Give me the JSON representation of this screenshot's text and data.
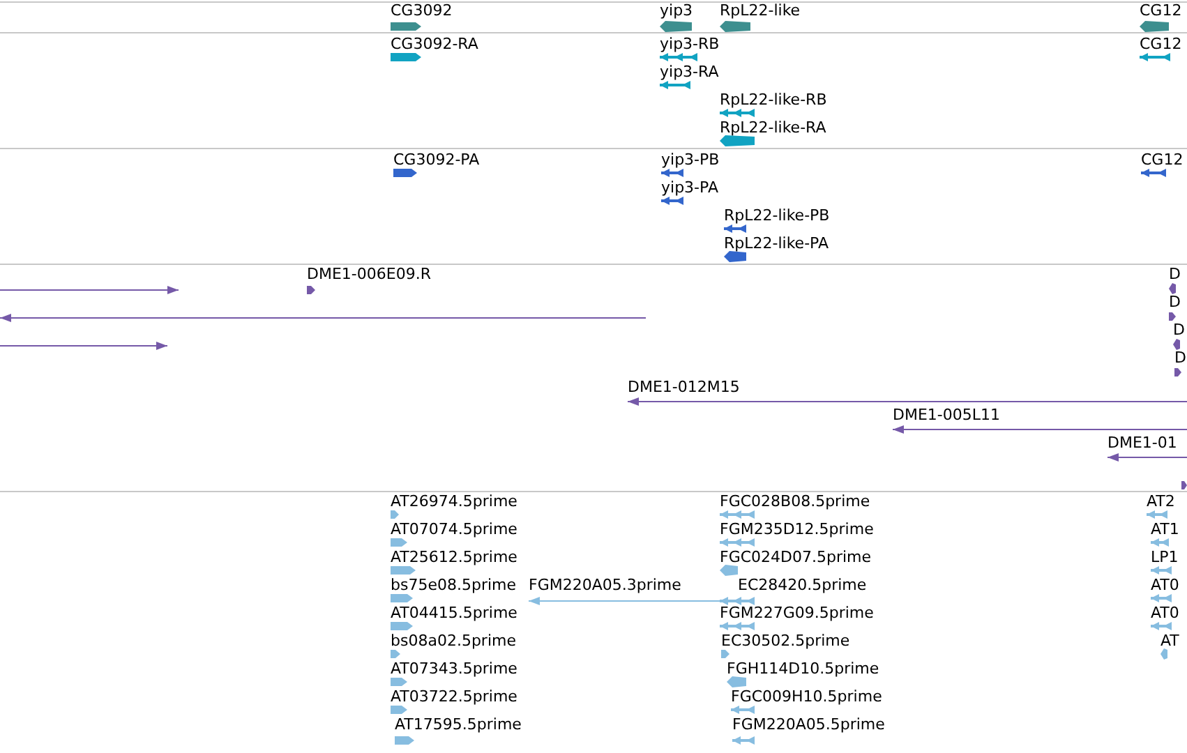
{
  "tracks": [
    {
      "color": "#3d8f8f",
      "features": [
        {
          "label": "CG3092",
          "reverse": false,
          "kind": "block"
        },
        {
          "label": "yip3",
          "reverse": true,
          "kind": "block"
        },
        {
          "label": "RpL22-like",
          "reverse": true,
          "kind": "block"
        },
        {
          "label": "CG12",
          "reverse": true,
          "kind": "block"
        }
      ]
    },
    {
      "color": "#11a3c2",
      "features": [
        {
          "label": "CG3092-RA",
          "reverse": false,
          "kind": "block"
        },
        {
          "label": "yip3-RB",
          "reverse": true,
          "kind": "spliced"
        },
        {
          "label": "yip3-RA",
          "reverse": true,
          "kind": "spliced"
        },
        {
          "label": "RpL22-like-RB",
          "reverse": true,
          "kind": "spliced"
        },
        {
          "label": "RpL22-like-RA",
          "reverse": true,
          "kind": "block"
        },
        {
          "label": "CG12",
          "reverse": true,
          "kind": "spliced"
        }
      ]
    },
    {
      "color": "#3366cc",
      "features": [
        {
          "label": "CG3092-PA",
          "reverse": false,
          "kind": "block"
        },
        {
          "label": "yip3-PB",
          "reverse": true,
          "kind": "spliced"
        },
        {
          "label": "yip3-PA",
          "reverse": true,
          "kind": "spliced"
        },
        {
          "label": "RpL22-like-PB",
          "reverse": true,
          "kind": "spliced"
        },
        {
          "label": "RpL22-like-PA",
          "reverse": true,
          "kind": "block"
        },
        {
          "label": "CG12",
          "reverse": true,
          "kind": "spliced"
        }
      ]
    },
    {
      "color": "#7559a8",
      "features": [
        {
          "reverse": false,
          "kind": "line"
        },
        {
          "label": "DME1-006E09.R",
          "reverse": false,
          "kind": "block"
        },
        {
          "reverse": true,
          "kind": "line"
        },
        {
          "reverse": false,
          "kind": "line"
        },
        {
          "label": "D",
          "reverse": true,
          "kind": "block"
        },
        {
          "label": "D",
          "reverse": false,
          "kind": "block"
        },
        {
          "label": "D",
          "reverse": true,
          "kind": "block"
        },
        {
          "label": "D",
          "reverse": false,
          "kind": "block"
        },
        {
          "label": "DME1-012M15",
          "reverse": true,
          "kind": "line"
        },
        {
          "label": "DME1-005L11",
          "reverse": true,
          "kind": "line"
        },
        {
          "label": "DME1-01",
          "reverse": true,
          "kind": "line"
        },
        {
          "reverse": false,
          "kind": "block"
        }
      ]
    },
    {
      "color": "#87bde0",
      "features": [
        {
          "label": "AT26974.5prime",
          "reverse": false,
          "kind": "block"
        },
        {
          "label": "AT07074.5prime",
          "reverse": false,
          "kind": "block"
        },
        {
          "label": "AT25612.5prime",
          "reverse": false,
          "kind": "block"
        },
        {
          "label": "bs75e08.5prime",
          "reverse": false,
          "kind": "block"
        },
        {
          "label": "AT04415.5prime",
          "reverse": false,
          "kind": "block"
        },
        {
          "label": "bs08a02.5prime",
          "reverse": false,
          "kind": "block"
        },
        {
          "label": "AT07343.5prime",
          "reverse": false,
          "kind": "block"
        },
        {
          "label": "AT03722.5prime",
          "reverse": false,
          "kind": "block"
        },
        {
          "label": "AT17595.5prime",
          "reverse": false,
          "kind": "block"
        },
        {
          "label": "FGM220A05.3prime",
          "reverse": true,
          "kind": "line"
        },
        {
          "label": "FGC028B08.5prime",
          "reverse": true,
          "kind": "spliced"
        },
        {
          "label": "FGM235D12.5prime",
          "reverse": true,
          "kind": "spliced"
        },
        {
          "label": "FGC024D07.5prime",
          "reverse": true,
          "kind": "block"
        },
        {
          "label": "EC28420.5prime",
          "reverse": true,
          "kind": "spliced"
        },
        {
          "label": "FGM227G09.5prime",
          "reverse": true,
          "kind": "spliced"
        },
        {
          "label": "EC30502.5prime",
          "reverse": false,
          "kind": "block"
        },
        {
          "label": "FGH114D10.5prime",
          "reverse": true,
          "kind": "block"
        },
        {
          "label": "FGC009H10.5prime",
          "reverse": true,
          "kind": "spliced"
        },
        {
          "label": "FGM220A05.5prime",
          "reverse": true,
          "kind": "spliced"
        },
        {
          "label": "AT2",
          "reverse": true,
          "kind": "spliced"
        },
        {
          "label": "AT1",
          "reverse": true,
          "kind": "spliced"
        },
        {
          "label": "LP1",
          "reverse": true,
          "kind": "spliced"
        },
        {
          "label": "AT0",
          "reverse": true,
          "kind": "spliced"
        },
        {
          "label": "AT0",
          "reverse": true,
          "kind": "spliced"
        },
        {
          "label": "AT",
          "reverse": true,
          "kind": "block"
        }
      ]
    }
  ]
}
